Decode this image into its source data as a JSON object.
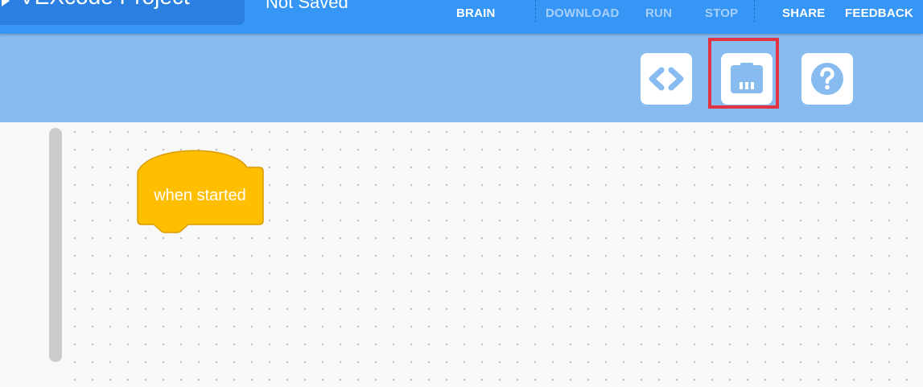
{
  "header": {
    "project_name": "VEXcode Project",
    "save_status": "Not Saved",
    "nav": {
      "brain": "BRAIN",
      "download": "DOWNLOAD",
      "run": "RUN",
      "stop": "STOP",
      "share": "SHARE",
      "feedback": "FEEDBACK"
    },
    "disabled_color": "#a9d0fa",
    "bar_color": "#3596f5"
  },
  "toolbar": {
    "buttons": [
      {
        "icon": "code-brackets-icon",
        "action": "code-viewer"
      },
      {
        "icon": "devices-port-icon",
        "action": "devices",
        "highlighted": true
      },
      {
        "icon": "help-question-icon",
        "action": "help"
      }
    ],
    "bar_color": "#88bcf1",
    "highlight_color": "#e23342"
  },
  "workspace": {
    "blocks": [
      {
        "type": "event-hat",
        "label": "when started",
        "color": "#ffbf00"
      }
    ]
  }
}
